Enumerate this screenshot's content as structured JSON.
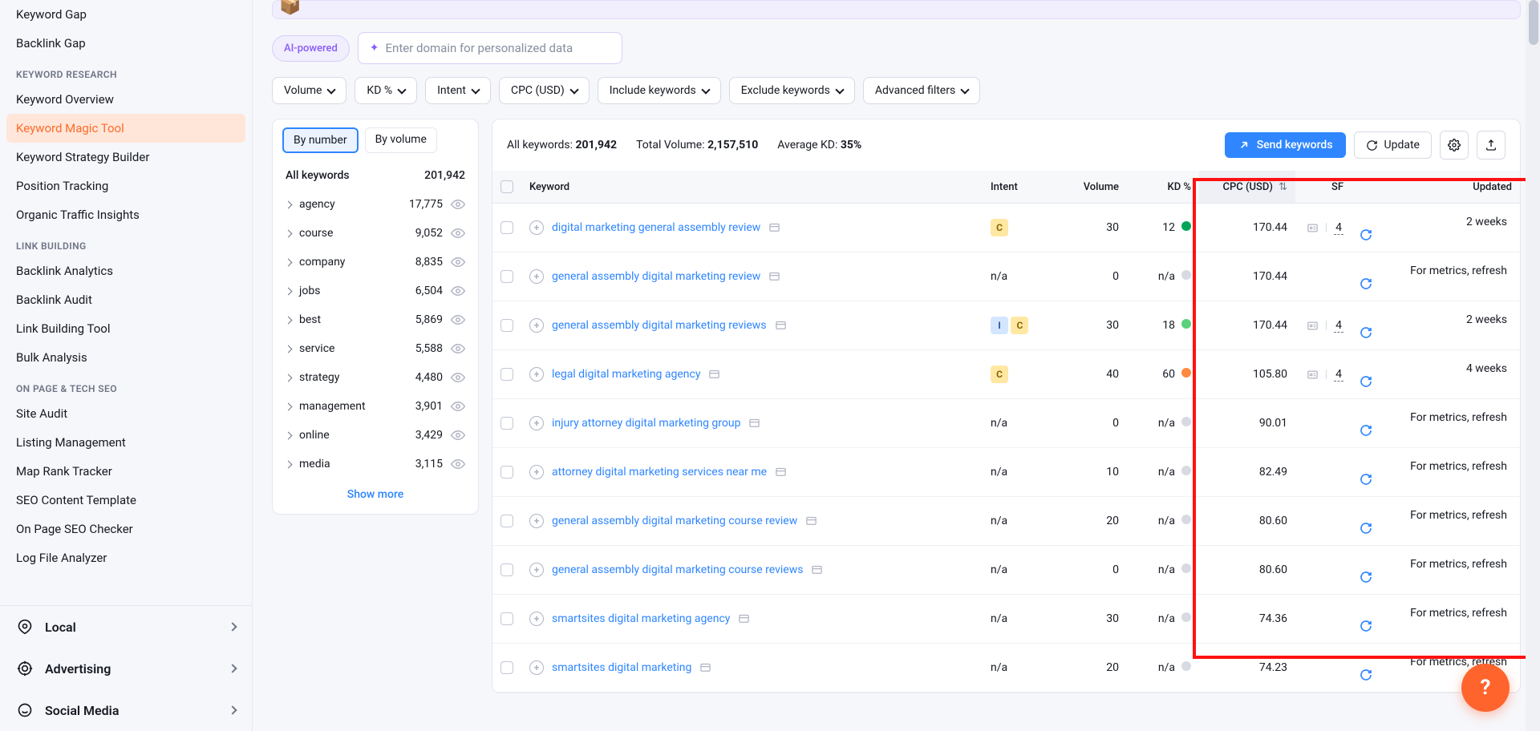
{
  "sidebar": {
    "top_items": [
      "Keyword Gap",
      "Backlink Gap"
    ],
    "sections": [
      {
        "title": "KEYWORD RESEARCH",
        "items": [
          "Keyword Overview",
          "Keyword Magic Tool",
          "Keyword Strategy Builder",
          "Position Tracking",
          "Organic Traffic Insights"
        ],
        "active_index": 1
      },
      {
        "title": "LINK BUILDING",
        "items": [
          "Backlink Analytics",
          "Backlink Audit",
          "Link Building Tool",
          "Bulk Analysis"
        ]
      },
      {
        "title": "ON PAGE & TECH SEO",
        "items": [
          "Site Audit",
          "Listing Management",
          "Map Rank Tracker",
          "SEO Content Template",
          "On Page SEO Checker",
          "Log File Analyzer"
        ]
      }
    ],
    "bottom": [
      "Local",
      "Advertising",
      "Social Media"
    ]
  },
  "ai_label": "AI-powered",
  "domain_placeholder": "Enter domain for personalized data",
  "filters": [
    "Volume",
    "KD %",
    "Intent",
    "CPC (USD)",
    "Include keywords",
    "Exclude keywords",
    "Advanced filters"
  ],
  "groups": {
    "tabs": [
      "By number",
      "By volume"
    ],
    "all_label": "All keywords",
    "all_count": "201,942",
    "items": [
      {
        "name": "agency",
        "count": "17,775"
      },
      {
        "name": "course",
        "count": "9,052"
      },
      {
        "name": "company",
        "count": "8,835"
      },
      {
        "name": "jobs",
        "count": "6,504"
      },
      {
        "name": "best",
        "count": "5,869"
      },
      {
        "name": "service",
        "count": "5,588"
      },
      {
        "name": "strategy",
        "count": "4,480"
      },
      {
        "name": "management",
        "count": "3,901"
      },
      {
        "name": "online",
        "count": "3,429"
      },
      {
        "name": "media",
        "count": "3,115"
      }
    ],
    "show_more": "Show more"
  },
  "summary": {
    "all_kw_label": "All keywords:",
    "all_kw_value": "201,942",
    "total_vol_label": "Total Volume:",
    "total_vol_value": "2,157,510",
    "avg_kd_label": "Average KD:",
    "avg_kd_value": "35%"
  },
  "actions": {
    "send": "Send keywords",
    "update": "Update"
  },
  "columns": [
    "Keyword",
    "Intent",
    "Volume",
    "KD %",
    "CPC (USD)",
    "SF",
    "Updated"
  ],
  "refresh_text": "For metrics, refresh",
  "rows": [
    {
      "kw": "digital marketing general assembly review",
      "intents": [
        "C"
      ],
      "vol": "30",
      "kd": "12",
      "kd_dot": "green",
      "cpc": "170.44",
      "sf": "4",
      "updated": "2 weeks"
    },
    {
      "kw": "general assembly digital marketing review",
      "intents": [],
      "intent_na": true,
      "vol": "0",
      "kd": "n/a",
      "kd_dot": "grey",
      "cpc": "170.44",
      "sf": null,
      "updated": null
    },
    {
      "kw": "general assembly digital marketing reviews",
      "intents": [
        "I",
        "C"
      ],
      "vol": "30",
      "kd": "18",
      "kd_dot": "lime",
      "cpc": "170.44",
      "sf": "4",
      "updated": "2 weeks"
    },
    {
      "kw": "legal digital marketing agency",
      "intents": [
        "C"
      ],
      "vol": "40",
      "kd": "60",
      "kd_dot": "orange",
      "cpc": "105.80",
      "sf": "4",
      "updated": "4 weeks"
    },
    {
      "kw": "injury attorney digital marketing group",
      "intents": [],
      "intent_na": true,
      "vol": "0",
      "kd": "n/a",
      "kd_dot": "grey",
      "cpc": "90.01",
      "sf": null,
      "updated": null
    },
    {
      "kw": "attorney digital marketing services near me",
      "intents": [],
      "intent_na": true,
      "vol": "10",
      "kd": "n/a",
      "kd_dot": "grey",
      "cpc": "82.49",
      "sf": null,
      "updated": null
    },
    {
      "kw": "general assembly digital marketing course review",
      "intents": [],
      "intent_na": true,
      "vol": "20",
      "kd": "n/a",
      "kd_dot": "grey",
      "cpc": "80.60",
      "sf": null,
      "updated": null
    },
    {
      "kw": "general assembly digital marketing course reviews",
      "intents": [],
      "intent_na": true,
      "vol": "0",
      "kd": "n/a",
      "kd_dot": "grey",
      "cpc": "80.60",
      "sf": null,
      "updated": null
    },
    {
      "kw": "smartsites digital marketing agency",
      "intents": [],
      "intent_na": true,
      "vol": "30",
      "kd": "n/a",
      "kd_dot": "grey",
      "cpc": "74.36",
      "sf": null,
      "updated": null
    },
    {
      "kw": "smartsites digital marketing",
      "intents": [],
      "intent_na": true,
      "vol": "20",
      "kd": "n/a",
      "kd_dot": "grey",
      "cpc": "74.23",
      "sf": null,
      "updated": null
    }
  ]
}
